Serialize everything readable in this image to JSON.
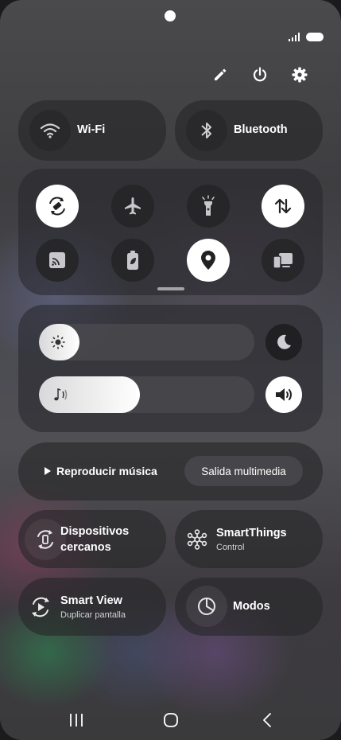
{
  "status_bar": {
    "signal_icon": "signal-bars-icon",
    "battery_icon": "battery-icon"
  },
  "top_actions": [
    {
      "name": "edit-icon"
    },
    {
      "name": "power-icon"
    },
    {
      "name": "settings-icon"
    }
  ],
  "wifi": {
    "label": "Wi-Fi",
    "icon": "wifi-icon"
  },
  "bluetooth": {
    "label": "Bluetooth",
    "icon": "bluetooth-icon"
  },
  "quick_toggles": [
    {
      "icon": "auto-rotate-icon",
      "on": true
    },
    {
      "icon": "airplane-icon",
      "on": false
    },
    {
      "icon": "flashlight-icon",
      "on": false
    },
    {
      "icon": "mobile-data-icon",
      "on": true
    },
    {
      "icon": "cast-icon",
      "on": false
    },
    {
      "icon": "power-saving-icon",
      "on": false
    },
    {
      "icon": "location-icon",
      "on": true
    },
    {
      "icon": "device-switch-icon",
      "on": false
    }
  ],
  "brightness": {
    "level": 0.19,
    "icon": "sun-icon"
  },
  "volume": {
    "level": 0.47,
    "icon": "music-note-icon"
  },
  "night_mode_icon": "moon-icon",
  "sound_icon": "speaker-icon",
  "media": {
    "play_label": "Reproducir música",
    "output_label": "Salida multimedia"
  },
  "nearby": {
    "line1": "Dispositivos",
    "line2": "cercanos"
  },
  "smartthings": {
    "title": "SmartThings",
    "subtitle": "Control"
  },
  "smartview": {
    "title": "Smart View",
    "subtitle": "Duplicar pantalla"
  },
  "modes": {
    "label": "Modos"
  },
  "navigation": [
    "recent-apps-icon",
    "home-icon",
    "back-icon"
  ]
}
